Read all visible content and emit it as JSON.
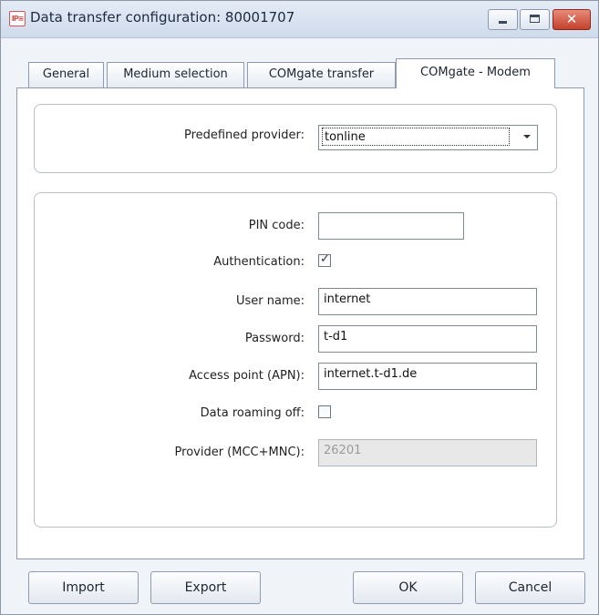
{
  "window": {
    "title": "Data transfer configuration: 80001707",
    "icon": "ipe-app-icon",
    "controls": {
      "minimize": "minimize-icon",
      "maximize": "maximize-icon",
      "close": "close-icon"
    }
  },
  "tabs": [
    {
      "label": "General",
      "active": false
    },
    {
      "label": "Medium selection",
      "active": false
    },
    {
      "label": "COMgate transfer",
      "active": false
    },
    {
      "label": "COMgate - Modem",
      "active": true
    }
  ],
  "provider_group": {
    "label": "Predefined provider:",
    "value": "tonline"
  },
  "modem_group": {
    "pin": {
      "label": "PIN code:",
      "value": ""
    },
    "authentication": {
      "label": "Authentication:",
      "checked": true
    },
    "username": {
      "label": "User name:",
      "value": "internet"
    },
    "password": {
      "label": "Password:",
      "value": "t-d1"
    },
    "apn": {
      "label": "Access point (APN):",
      "value": "internet.t-d1.de"
    },
    "roaming": {
      "label": "Data roaming off:",
      "checked": false
    },
    "mccmnc": {
      "label": "Provider (MCC+MNC):",
      "value": "26201",
      "disabled": true
    }
  },
  "buttons": {
    "import": "Import",
    "export": "Export",
    "ok": "OK",
    "cancel": "Cancel"
  },
  "colors": {
    "titlebar": "#d8e2ef",
    "close_button": "#c3412b",
    "background": "#f0f3f8",
    "disabled_field": "#e8e8e8"
  }
}
